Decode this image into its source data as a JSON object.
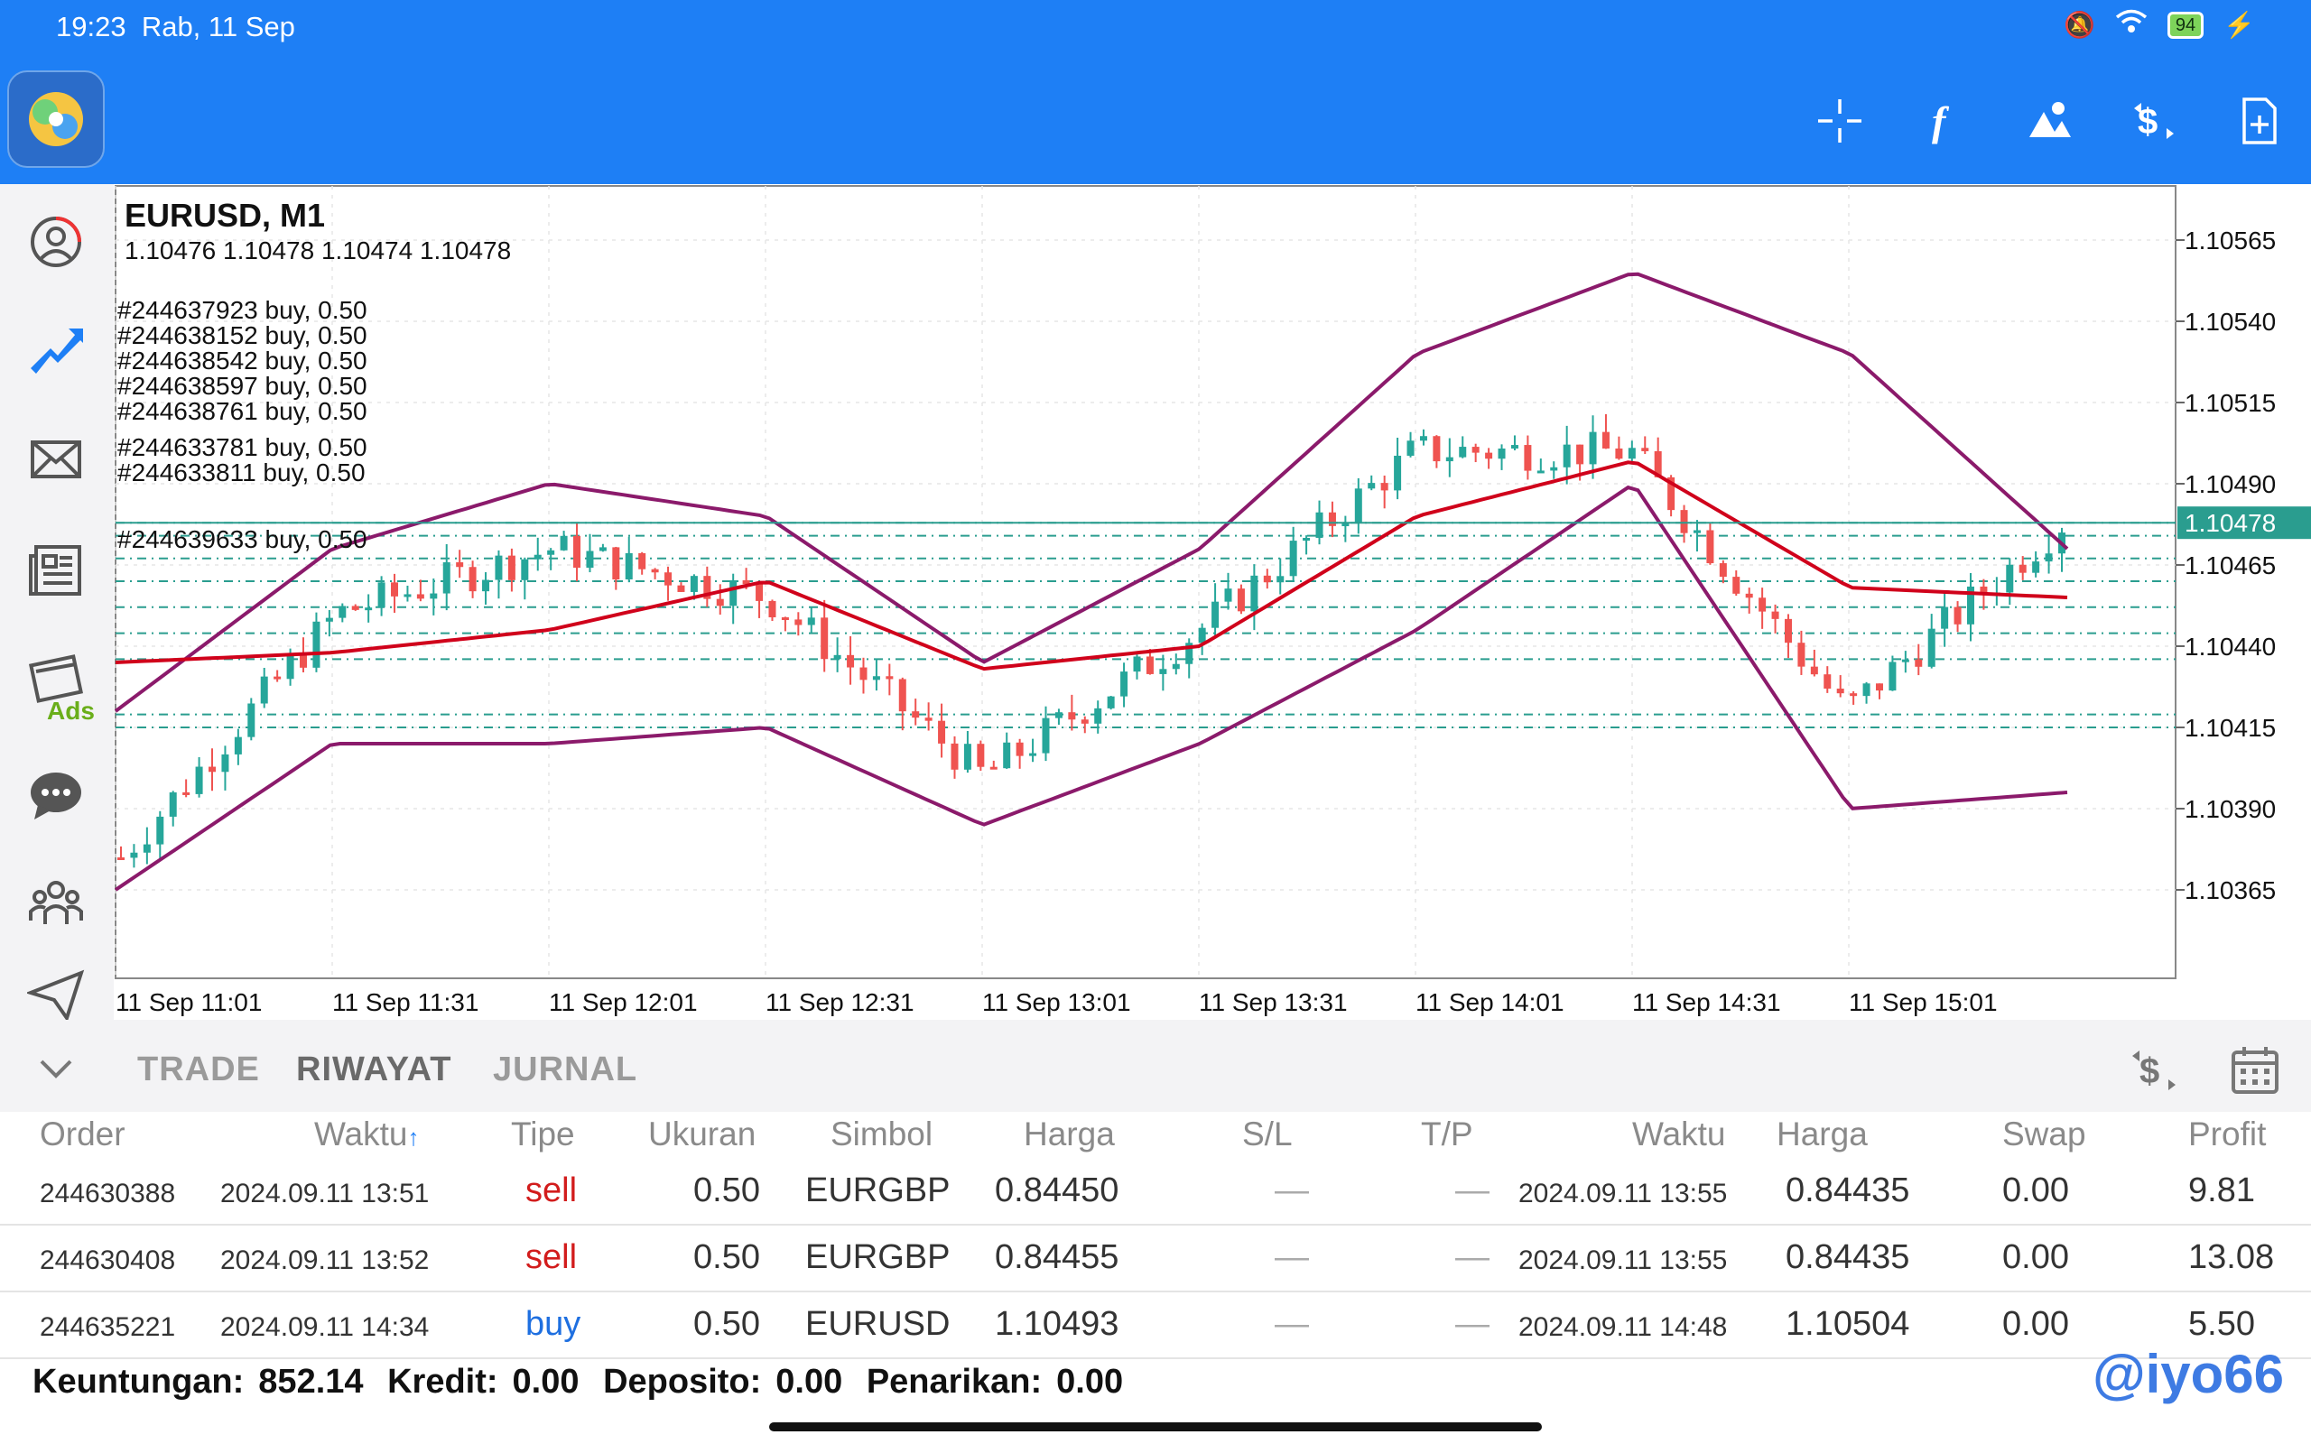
{
  "status_bar": {
    "time": "19:23",
    "date": "Rab, 11 Sep",
    "battery": "94"
  },
  "toolbar": {
    "icons": [
      "crosshair-icon",
      "indicator-f-icon",
      "objects-icon",
      "trade-dollar-icon",
      "new-document-icon"
    ]
  },
  "sidebar": {
    "items": [
      "quotes-icon",
      "chart-icon",
      "mail-icon",
      "news-icon",
      "calendar-ads-icon",
      "chat-icon",
      "community-icon",
      "send-icon"
    ],
    "ads_label": "Ads"
  },
  "chart": {
    "symbol": "EURUSD, M1",
    "ohlc": "1.10476 1.10478 1.10474 1.10478",
    "current_price": "1.10478",
    "price_ticks": [
      "1.10565",
      "1.10540",
      "1.10515",
      "1.10490",
      "1.10465",
      "1.10440",
      "1.10415",
      "1.10390",
      "1.10365"
    ],
    "time_ticks": [
      "11 Sep 11:01",
      "11 Sep 11:31",
      "11 Sep 12:01",
      "11 Sep 12:31",
      "11 Sep 13:01",
      "11 Sep 13:31",
      "11 Sep 14:01",
      "11 Sep 14:31",
      "11 Sep 15:01"
    ],
    "trade_labels": [
      "#244637923 buy, 0.50",
      "#244638152 buy, 0.50",
      "#244638542 buy, 0.50",
      "#244638597 buy, 0.50",
      "#244638761 buy, 0.50",
      "#244633781 buy, 0.50",
      "#244633811 buy, 0.50",
      "#244639633 buy, 0.50"
    ]
  },
  "chart_data": {
    "type": "candlestick",
    "title": "EURUSD, M1",
    "x": [
      "11:01",
      "11:31",
      "12:01",
      "12:31",
      "13:01",
      "13:31",
      "14:01",
      "14:31",
      "15:01",
      "15:20"
    ],
    "ylim": [
      1.10365,
      1.10565
    ],
    "series": [
      {
        "name": "Close",
        "values": [
          1.10375,
          1.1045,
          1.1047,
          1.10455,
          1.104,
          1.10445,
          1.105,
          1.105,
          1.1042,
          1.10478
        ]
      },
      {
        "name": "MA",
        "values": [
          1.10435,
          1.10438,
          1.10445,
          1.1046,
          1.10433,
          1.1044,
          1.1048,
          1.10497,
          1.10458,
          1.10455
        ]
      },
      {
        "name": "Upper band",
        "values": [
          1.1042,
          1.1047,
          1.1049,
          1.1048,
          1.10435,
          1.1047,
          1.1053,
          1.10555,
          1.1053,
          1.1047
        ]
      },
      {
        "name": "Lower band",
        "values": [
          1.10365,
          1.1041,
          1.1041,
          1.10415,
          1.10385,
          1.1041,
          1.10445,
          1.1049,
          1.1039,
          1.10395
        ]
      }
    ]
  },
  "panel": {
    "tabs": [
      "TRADE",
      "RIWAYAT",
      "JURNAL"
    ],
    "active_tab": "RIWAYAT",
    "columns": [
      "Order",
      "Waktu",
      "Tipe",
      "Ukuran",
      "Simbol",
      "Harga",
      "S/L",
      "T/P",
      "Waktu",
      "Harga",
      "Swap",
      "Profit"
    ],
    "rows": [
      {
        "order": "244630388",
        "time": "2024.09.11 13:51",
        "type": "sell",
        "size": "0.50",
        "symbol": "EURGBP",
        "price": "0.84450",
        "sl": "—",
        "tp": "—",
        "close_time": "2024.09.11 13:55",
        "close_price": "0.84435",
        "swap": "0.00",
        "profit": "9.81"
      },
      {
        "order": "244630408",
        "time": "2024.09.11 13:52",
        "type": "sell",
        "size": "0.50",
        "symbol": "EURGBP",
        "price": "0.84455",
        "sl": "—",
        "tp": "—",
        "close_time": "2024.09.11 13:55",
        "close_price": "0.84435",
        "swap": "0.00",
        "profit": "13.08"
      },
      {
        "order": "244635221",
        "time": "2024.09.11 14:34",
        "type": "buy",
        "size": "0.50",
        "symbol": "EURUSD",
        "price": "1.10493",
        "sl": "—",
        "tp": "—",
        "close_time": "2024.09.11 14:48",
        "close_price": "1.10504",
        "swap": "0.00",
        "profit": "5.50"
      }
    ],
    "summary": {
      "profit_label": "Keuntungan:",
      "profit": "852.14",
      "credit_label": "Kredit:",
      "credit": "0.00",
      "deposit_label": "Deposito:",
      "deposit": "0.00",
      "withdraw_label": "Penarikan:",
      "withdraw": "0.00"
    },
    "watermark": "@iyo66"
  },
  "colors": {
    "accent": "#1e7ff5",
    "bull": "#26a69a",
    "bear": "#ef5350",
    "ma": "#d0021b",
    "band": "#8b1a6b",
    "grid": "#e6e6e6"
  }
}
